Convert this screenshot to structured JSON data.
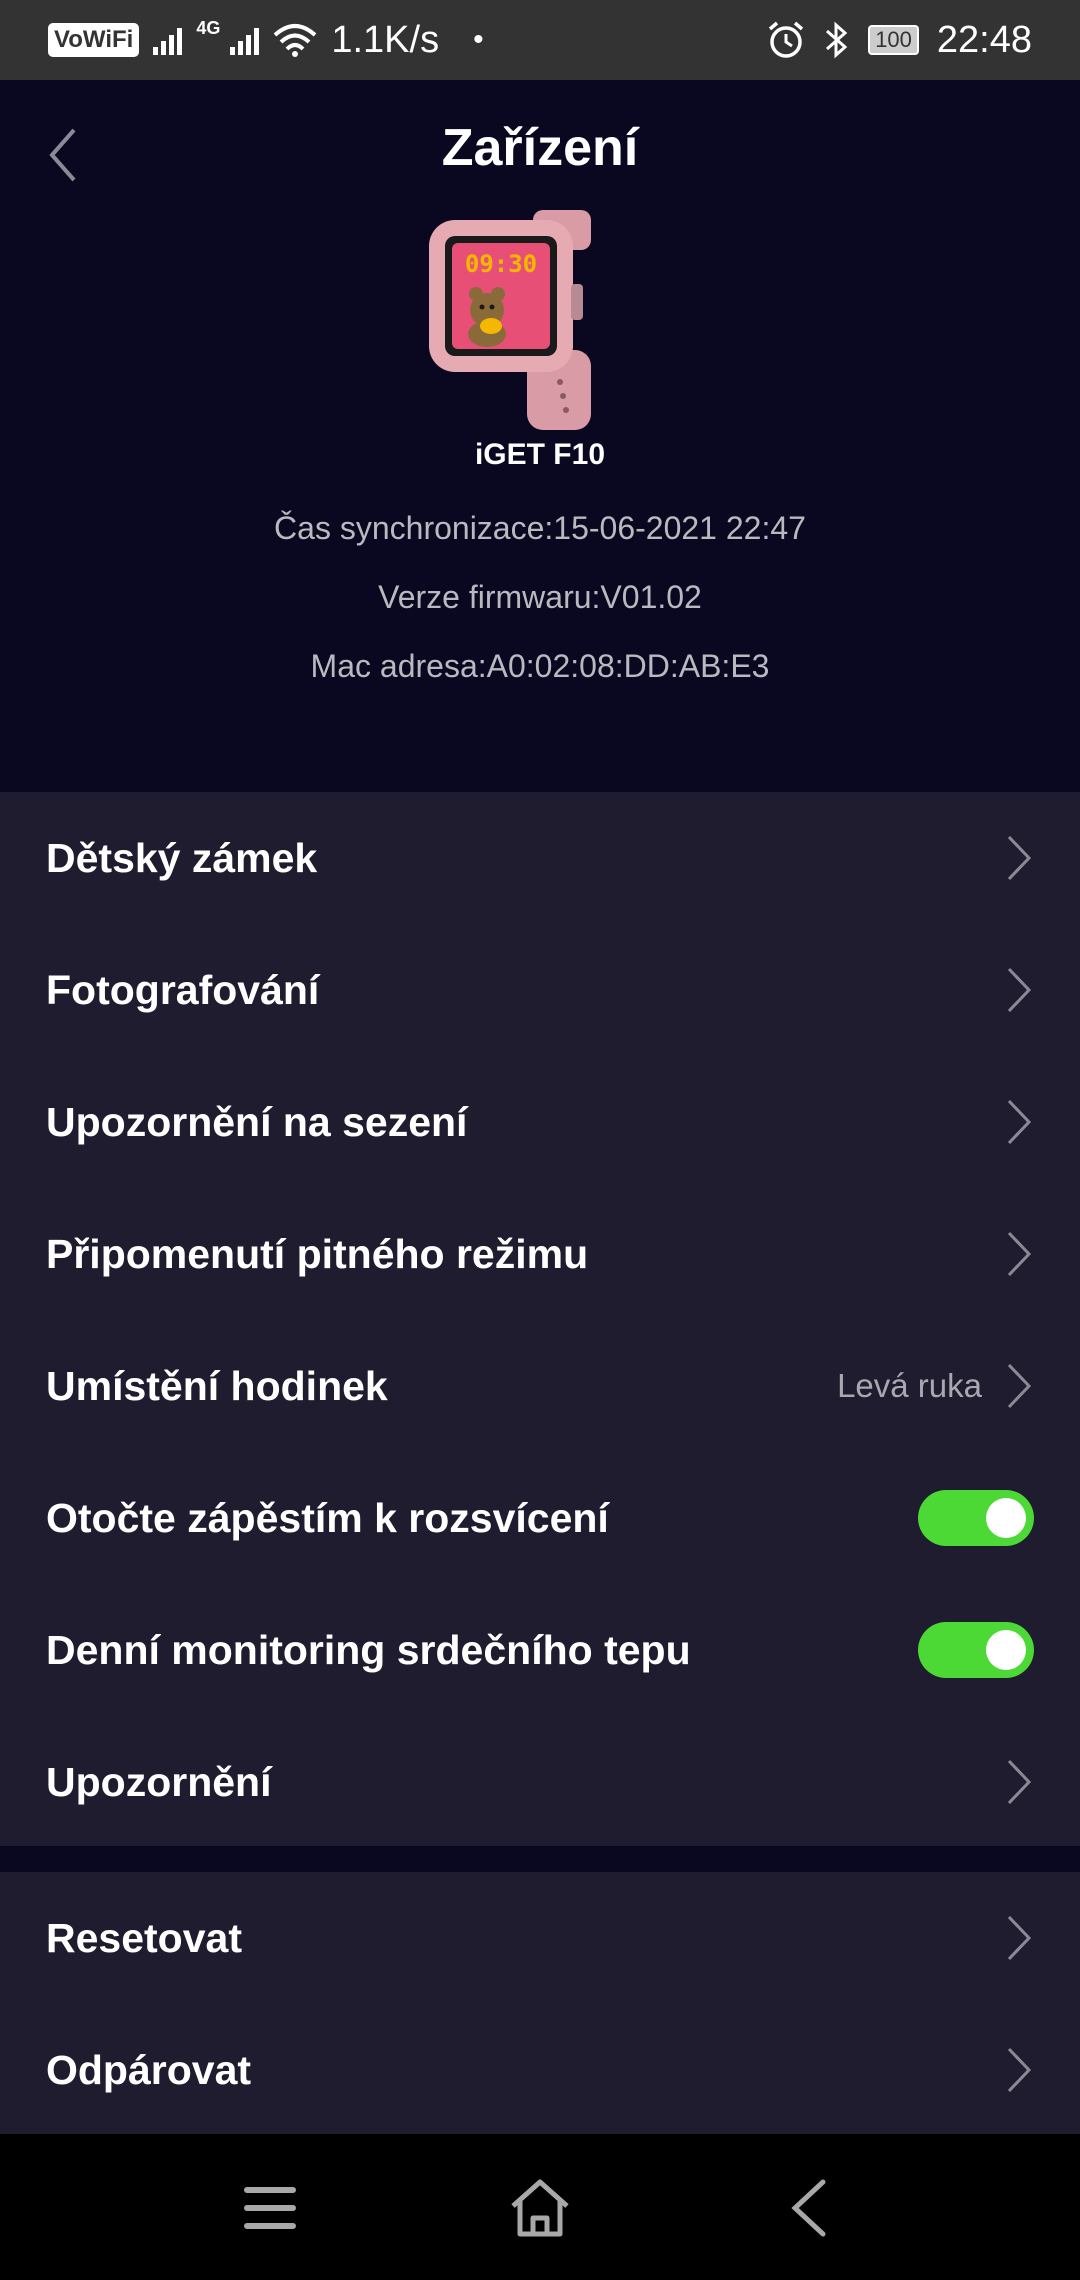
{
  "status_bar": {
    "vowifi": "VoWiFi",
    "network": "4G",
    "speed": "1.1K/s",
    "dot": "•",
    "battery": "100",
    "time": "22:48",
    "icons": [
      "signal-icon",
      "wifi-icon",
      "alarm-icon",
      "bluetooth-icon",
      "battery-icon"
    ]
  },
  "header": {
    "title": "Zařízení",
    "device_name": "iGET F10",
    "watch_time": "09:30",
    "sync_time": "Čas synchronizace:15-06-2021 22:47",
    "firmware": "Verze firmwaru:V01.02",
    "mac": "Mac adresa:A0:02:08:DD:AB:E3"
  },
  "settings": [
    {
      "label": "Dětský zámek",
      "type": "link"
    },
    {
      "label": "Fotografování",
      "type": "link"
    },
    {
      "label": "Upozornění na sezení",
      "type": "link"
    },
    {
      "label": "Připomenutí pitného režimu",
      "type": "link"
    },
    {
      "label": "Umístění hodinek",
      "type": "link",
      "value": "Levá ruka"
    },
    {
      "label": "Otočte zápěstím k rozsvícení",
      "type": "toggle",
      "on": true
    },
    {
      "label": "Denní monitoring srdečního tepu",
      "type": "toggle",
      "on": true
    },
    {
      "label": "Upozornění",
      "type": "link"
    }
  ],
  "actions": [
    {
      "label": "Resetovat"
    },
    {
      "label": "Odpárovat"
    }
  ],
  "colors": {
    "background": "#0a0820",
    "section": "#1e1c2e",
    "toggle_on": "#4cd835",
    "secondary_text": "#b9b9c0"
  }
}
